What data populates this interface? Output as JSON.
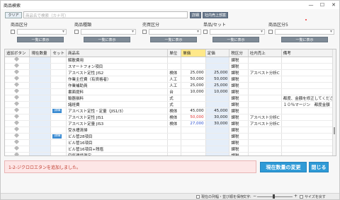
{
  "window": {
    "title": "商品検索"
  },
  "search": {
    "clear_label": "クリア",
    "placeholder": "商品名で検索（カナ可）",
    "detail_label": "詳細",
    "sales_label": "社内売上部案"
  },
  "filters": [
    {
      "label": "商品区分",
      "button": "一覧に表示"
    },
    {
      "label": "商品種類",
      "button": "一覧に表示"
    },
    {
      "label": "売買区分",
      "button": "一覧に表示"
    },
    {
      "label": "単品/セット",
      "button": "一覧に表示"
    },
    {
      "label": "商品区分5",
      "button": "一覧に表示"
    }
  ],
  "table": {
    "columns": [
      "追加ボタン",
      "現在数量",
      "セット",
      "商品名",
      "単位",
      "単価",
      "定価",
      "税区分",
      "社内売上",
      "備考"
    ],
    "highlight_column": "単価",
    "rows": [
      {
        "set": "",
        "name": "解散費用",
        "unit": "",
        "price": "",
        "list": "",
        "tax": "課税",
        "internal": "",
        "note": ""
      },
      {
        "set": "",
        "name": "スマートフォン項目",
        "unit": "",
        "price": "",
        "list": "",
        "tax": "課税",
        "internal": "",
        "note": ""
      },
      {
        "set": "",
        "name": "アスベスト定性 JIS2",
        "unit": "検体",
        "price": "25,000",
        "list": "25,000",
        "tax": "課税",
        "internal": "アスベスト分析C",
        "note": ""
      },
      {
        "set": "",
        "name": "作業主任費（有資格者）",
        "unit": "人工",
        "price": "50,000",
        "list": "50,000",
        "tax": "課税",
        "internal": "",
        "note": ""
      },
      {
        "set": "",
        "name": "作業補助員",
        "unit": "人工",
        "price": "25,000",
        "list": "25,000",
        "tax": "課税",
        "internal": "",
        "note": ""
      },
      {
        "set": "",
        "name": "書面提料",
        "unit": "台",
        "price": "10,000",
        "list": "10,000",
        "tax": "課税",
        "internal": "",
        "note": ""
      },
      {
        "set": "",
        "name": "輸器損料",
        "unit": "式",
        "price": "",
        "list": "",
        "tax": "課税",
        "internal": "",
        "note": "都度、金額を修正してくださ"
      },
      {
        "set": "",
        "name": "諸経費",
        "unit": "式",
        "price": "",
        "list": "",
        "tax": "課税",
        "internal": "",
        "note": "１０％マージン　都度金額"
      },
      {
        "set": "詳細",
        "name": "アスベスト定性・定量（JIS1/3）",
        "unit": "検体",
        "price": "45,000",
        "list": "45,000",
        "tax": "課税",
        "internal": "",
        "note": ""
      },
      {
        "set": "",
        "name": "アスベスト定性 JIS1",
        "unit": "検体",
        "price": "50,000",
        "list": "30,000",
        "tax": "課税",
        "internal": "アスベスト分析C",
        "note": ""
      },
      {
        "set": "",
        "name": "アスベスト定量 JIS3",
        "unit": "検体",
        "price": "27,000",
        "list": "30,000",
        "tax": "課税",
        "internal": "アスベスト分析C",
        "note": ""
      },
      {
        "set": "",
        "name": "受水槽清掃",
        "unit": "",
        "price": "",
        "list": "",
        "tax": "課税",
        "internal": "",
        "note": ""
      },
      {
        "set": "詳細",
        "name": "ビル管28項目",
        "unit": "",
        "price": "",
        "list": "",
        "tax": "課税",
        "internal": "",
        "note": ""
      },
      {
        "set": "",
        "name": "ビル管16項目",
        "unit": "",
        "price": "",
        "list": "",
        "tax": "課税",
        "internal": "",
        "note": ""
      },
      {
        "set": "",
        "name": "ビル管16項目+残塩",
        "unit": "",
        "price": "",
        "list": "",
        "tax": "課税",
        "internal": "",
        "note": ""
      },
      {
        "set": "",
        "name": "空気環境測定",
        "unit": "",
        "price": "",
        "list": "",
        "tax": "課税",
        "internal": "",
        "note": ""
      },
      {
        "set": "",
        "name": "ばい煙測定",
        "unit": "",
        "price": "",
        "list": "",
        "tax": "課税",
        "internal": "",
        "note": ""
      },
      {
        "set": "",
        "name": "ビル管11項目",
        "unit": "",
        "price": "",
        "list": "",
        "tax": "課税",
        "internal": "",
        "note": ""
      }
    ]
  },
  "message": "1-2-ジクロロエタンを追加しました。",
  "actions": {
    "change_label": "現在数量の変更",
    "close_label": "閉じる"
  },
  "statusbar": {
    "save_label": "現在の列幅・並び順を保存",
    "font_label": "文字:",
    "resize_label": "サイズを戻す"
  },
  "colors": {
    "accent": "#2f9ad6",
    "header_highlight": "#ffe88a",
    "error_bg": "#fde6e6",
    "qty_column_bg": "#e5eef9"
  }
}
